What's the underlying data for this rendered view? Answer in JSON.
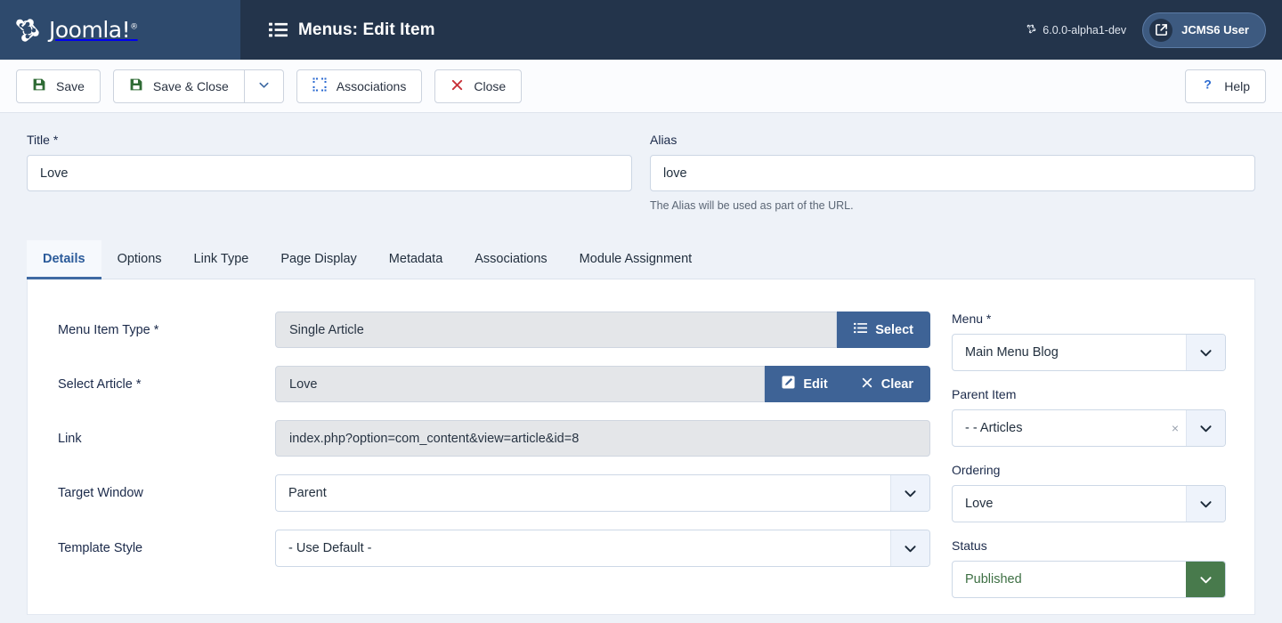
{
  "header": {
    "brand_name": "Joomla!",
    "brand_mark": "®",
    "title": "Menus: Edit Item",
    "version": "6.0.0-alpha1-dev",
    "user_label": "JCMS6 User"
  },
  "toolbar": {
    "save_label": "Save",
    "save_close_label": "Save & Close",
    "associations_label": "Associations",
    "close_label": "Close",
    "help_label": "Help"
  },
  "form_top": {
    "title_label": "Title *",
    "title_value": "Love",
    "title_placeholder": "",
    "alias_label": "Alias",
    "alias_value": "love",
    "alias_placeholder": "",
    "alias_help": "The Alias will be used as part of the URL."
  },
  "tabs": [
    {
      "label": "Details",
      "active": true
    },
    {
      "label": "Options",
      "active": false
    },
    {
      "label": "Link Type",
      "active": false
    },
    {
      "label": "Page Display",
      "active": false
    },
    {
      "label": "Metadata",
      "active": false
    },
    {
      "label": "Associations",
      "active": false
    },
    {
      "label": "Module Assignment",
      "active": false
    }
  ],
  "details": {
    "menu_item_type_label": "Menu Item Type *",
    "menu_item_type_value": "Single Article",
    "select_button_label": "Select",
    "select_article_label": "Select Article *",
    "select_article_value": "Love",
    "edit_button_label": "Edit",
    "clear_button_label": "Clear",
    "link_label": "Link",
    "link_value": "index.php?option=com_content&view=article&id=8",
    "target_window_label": "Target Window",
    "target_window_value": "Parent",
    "template_style_label": "Template Style",
    "template_style_value": "- Use Default -"
  },
  "sidebar": {
    "menu_label": "Menu *",
    "menu_value": "Main Menu Blog",
    "parent_item_label": "Parent Item",
    "parent_item_value": "- - Articles",
    "parent_item_clear": "×",
    "ordering_label": "Ordering",
    "ordering_value": "Love",
    "status_label": "Status",
    "status_value": "Published"
  },
  "colors": {
    "header_bg": "#23344b",
    "brand_bg": "#2e4a6d",
    "accent_blue": "#3e6396",
    "status_green": "#487a4c",
    "page_bg": "#eef2f8",
    "danger_red": "#c8323a"
  }
}
